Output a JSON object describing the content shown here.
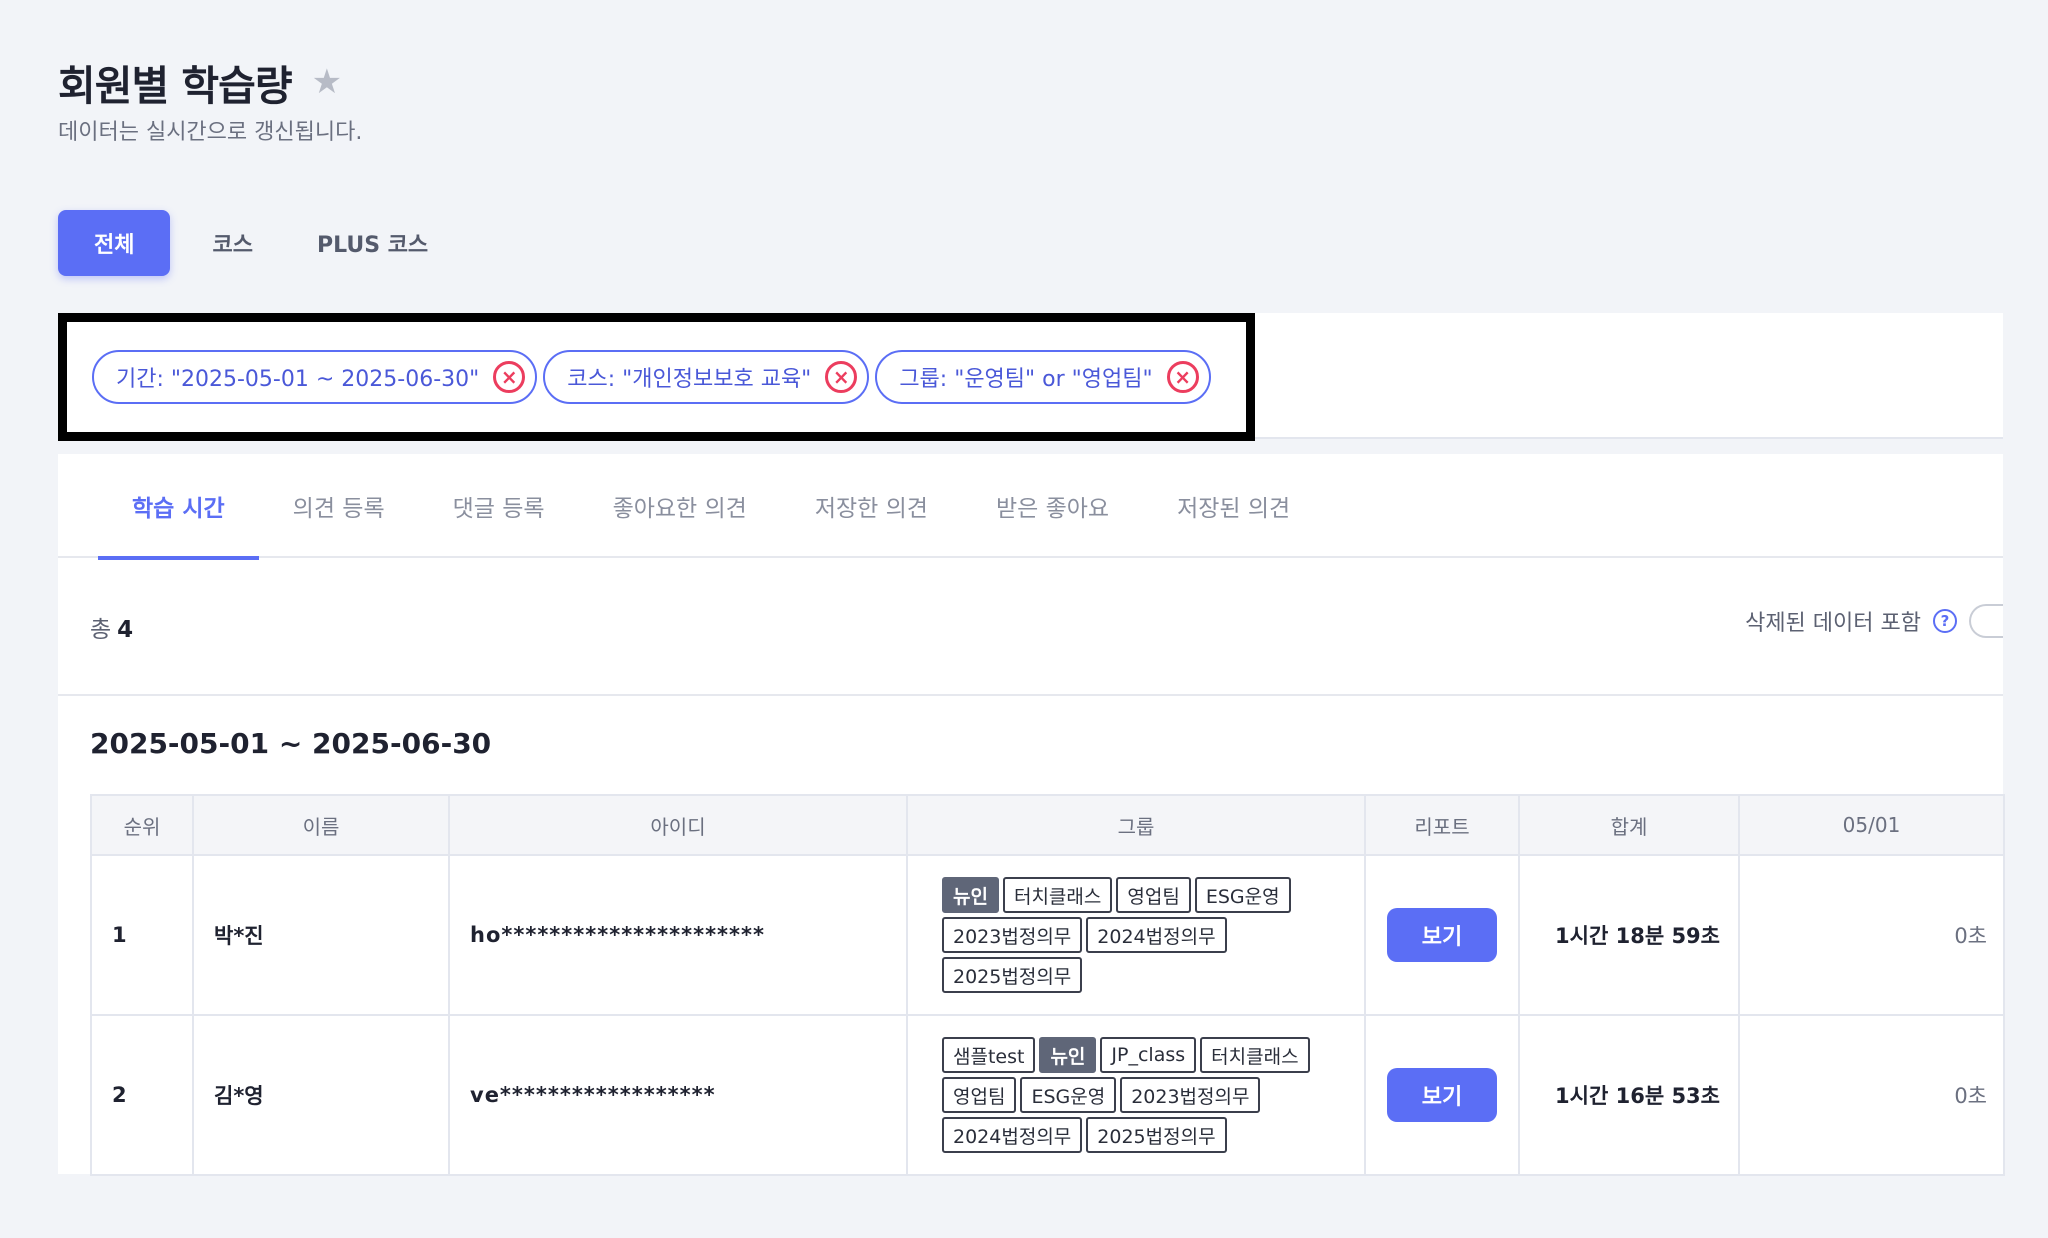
{
  "header": {
    "title": "회원별 학습량",
    "star_icon": "star-icon",
    "subtitle": "데이터는 실시간으로 갱신됩니다."
  },
  "top_tabs": [
    {
      "label": "전체",
      "active": true
    },
    {
      "label": "코스",
      "active": false
    },
    {
      "label": "PLUS 코스",
      "active": false
    }
  ],
  "filters": [
    {
      "label": "기간: \"2025-05-01 ~ 2025-06-30\""
    },
    {
      "label": "코스: \"개인정보보호 교육\""
    },
    {
      "label": "그룹: \"운영팀\" or \"영업팀\""
    }
  ],
  "filter_remove_symbol": "×",
  "sub_tabs": [
    {
      "label": "학습 시간",
      "active": true
    },
    {
      "label": "의견 등록"
    },
    {
      "label": "댓글 등록"
    },
    {
      "label": "좋아요한 의견"
    },
    {
      "label": "저장한 의견"
    },
    {
      "label": "받은 좋아요"
    },
    {
      "label": "저장된 의견"
    }
  ],
  "summary": {
    "total_label": "총",
    "total_count": "4",
    "deleted_label": "삭제된 데이터 포함",
    "help_symbol": "?",
    "include_deleted": false
  },
  "range_title": "2025-05-01 ~ 2025-06-30",
  "table": {
    "columns": [
      "순위",
      "이름",
      "아이디",
      "그룹",
      "리포트",
      "합계",
      "05/01"
    ],
    "rows": [
      {
        "rank": "1",
        "name": "박*진",
        "id": "ho**********************",
        "group_lines": [
          [
            {
              "text": "뉴인",
              "dark": true
            },
            {
              "text": "터치클래스"
            },
            {
              "text": "영업팀"
            },
            {
              "text": "ESG운영"
            }
          ],
          [
            {
              "text": "2023법정의무"
            },
            {
              "text": "2024법정의무"
            }
          ],
          [
            {
              "text": "2025법정의무"
            }
          ]
        ],
        "report_label": "보기",
        "total": "1시간 18분 59초",
        "day": "0초"
      },
      {
        "rank": "2",
        "name": "김*영",
        "id": "ve******************",
        "group_lines": [
          [
            {
              "text": "샘플test"
            },
            {
              "text": "뉴인",
              "dark": true
            },
            {
              "text": "JP_class"
            },
            {
              "text": "터치클래스"
            }
          ],
          [
            {
              "text": "영업팀"
            },
            {
              "text": "ESG운영"
            },
            {
              "text": "2023법정의무"
            }
          ],
          [
            {
              "text": "2024법정의무"
            },
            {
              "text": "2025법정의무"
            }
          ]
        ],
        "report_label": "보기",
        "total": "1시간 16분 53초",
        "day": "0초"
      }
    ]
  }
}
